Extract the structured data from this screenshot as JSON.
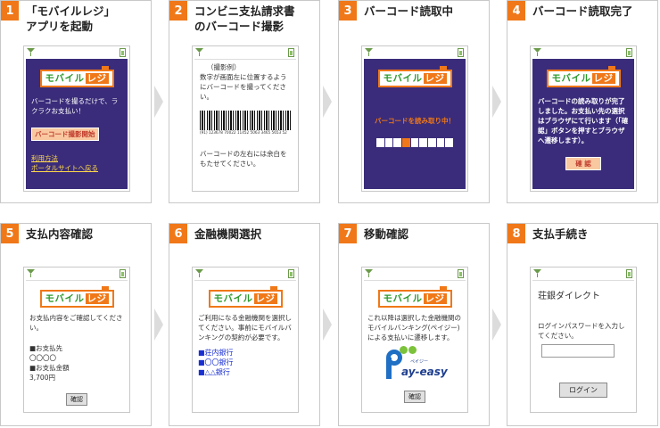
{
  "steps": [
    {
      "num": "1",
      "title": "「モバイルレジ」\nアプリを起動"
    },
    {
      "num": "2",
      "title": "コンビニ支払請求書\nのバーコード撮影"
    },
    {
      "num": "3",
      "title": "バーコード読取中"
    },
    {
      "num": "4",
      "title": "バーコード読取完了"
    },
    {
      "num": "5",
      "title": "支払内容確認"
    },
    {
      "num": "6",
      "title": "金融機関選択"
    },
    {
      "num": "7",
      "title": "移動確認"
    },
    {
      "num": "8",
      "title": "支払手続き"
    }
  ],
  "logo": {
    "main": "モバイル",
    "re": "レジ"
  },
  "s1": {
    "text": "バーコードを撮るだけで、ラクラクお支払い！",
    "button": "バーコード撮影開始",
    "link1": "利用方法",
    "link2": "ポータルサイトへ戻る"
  },
  "s2": {
    "example": "（撮影例）",
    "instruction": "数字が画面左に位置するようにバーコードを撮ってください。",
    "barcode_number": "(91) 123678 70022 11452 5063 3465 5653 52",
    "note": "バーコードの左右には余白をもたせてください。"
  },
  "s3": {
    "reading": "バーコードを読み取り中！",
    "progress": 0.35
  },
  "s4": {
    "text": "バーコードの読み取りが完了しました。お支払い先の選択はブラウザにて行います（「確認」ボタンを押すとブラウザへ遷移します）。",
    "button": "確 認"
  },
  "s5": {
    "text": "お支払内容をご確認してください。",
    "payee_label": "■お支払先",
    "payee": "〇〇〇〇",
    "amount_label": "■お支払金額",
    "amount": "3,700円",
    "button": "確認"
  },
  "s6": {
    "text": "ご利用になる金融機関を選択してください。事前にモバイルバンキングの契約が必要です。",
    "banks": [
      "■荘内銀行",
      "■〇〇銀行",
      "■△△銀行"
    ]
  },
  "s7": {
    "text": "これ以降は選択した金融機関のモバイルバンキング(ペイジー)による支払いに遷移します。",
    "payeasy_small": "ペイジー",
    "payeasy": "ay-easy",
    "button": "確認"
  },
  "s8": {
    "bank_name": "荘銀ダイレクト",
    "text": "ログインパスワードを入力してください。",
    "button": "ログイン"
  },
  "colors": {
    "accent": "#f07818",
    "screen_dark": "#3a2c7a",
    "link": "#ffd84a",
    "bank_link": "#1a2fd0"
  }
}
